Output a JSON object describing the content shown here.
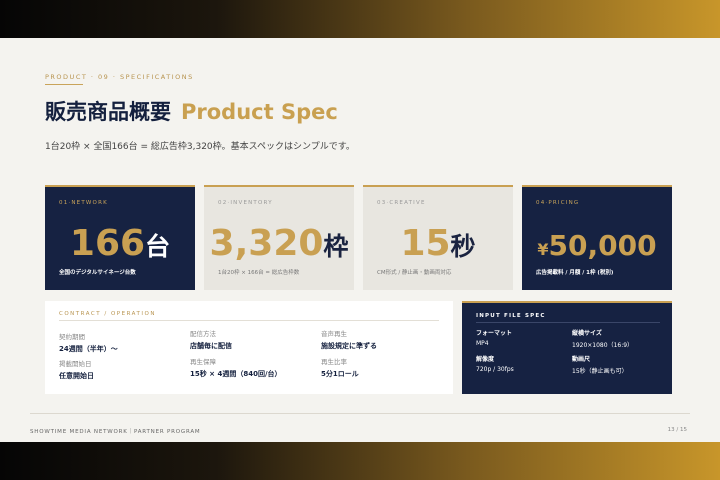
{
  "header": {
    "eyebrow": "PRODUCT · 09 · SPECIFICATIONS",
    "title_ja": "販売商品概要",
    "title_en": "Product Spec",
    "subtitle": "1台20枠 × 全国166台 = 総広告枠3,320枠。基本スペックはシンプルです。"
  },
  "cards": [
    {
      "label": "01·NETWORK",
      "number": "166",
      "unit": "台",
      "note": "全国のデジタルサイネージ台数"
    },
    {
      "label": "02·INVENTORY",
      "number": "3,320",
      "unit": "枠",
      "note": "1台20枠 × 166台 = 総広告枠数"
    },
    {
      "label": "03·CREATIVE",
      "number": "15",
      "unit": "秒",
      "note": "CM形式 / 静止画・動画両対応"
    },
    {
      "label": "04·PRICING",
      "currency": "¥",
      "number": "50,000",
      "note": "広告掲載料 / 月額 / 1枠 (税別)"
    }
  ],
  "contract": {
    "heading": "CONTRACT / OPERATION",
    "items": [
      {
        "key": "契約期間",
        "value": "24週間（半年）〜"
      },
      {
        "key": "配信方法",
        "value": "店舗毎に配信"
      },
      {
        "key": "音声再生",
        "value": "施設規定に準ずる"
      },
      {
        "key": "掲載開始日",
        "value": "任意開始日"
      },
      {
        "key": "再生保障",
        "value": "15秒 × 4週間（840回/台）"
      },
      {
        "key": "再生比率",
        "value": "5分1ロール"
      }
    ]
  },
  "spec": {
    "heading": "INPUT FILE SPEC",
    "items": [
      {
        "key": "フォーマット",
        "value": "MP4"
      },
      {
        "key": "縦横サイズ",
        "value": "1920×1080（16:9）"
      },
      {
        "key": "解像度",
        "value": "720p / 30fps"
      },
      {
        "key": "動画尺",
        "value": "15秒（静止画も可）"
      }
    ]
  },
  "footer": {
    "left": "SHOWTIME MEDIA NETWORK｜PARTNER PROGRAM",
    "right": "13 / 15"
  }
}
